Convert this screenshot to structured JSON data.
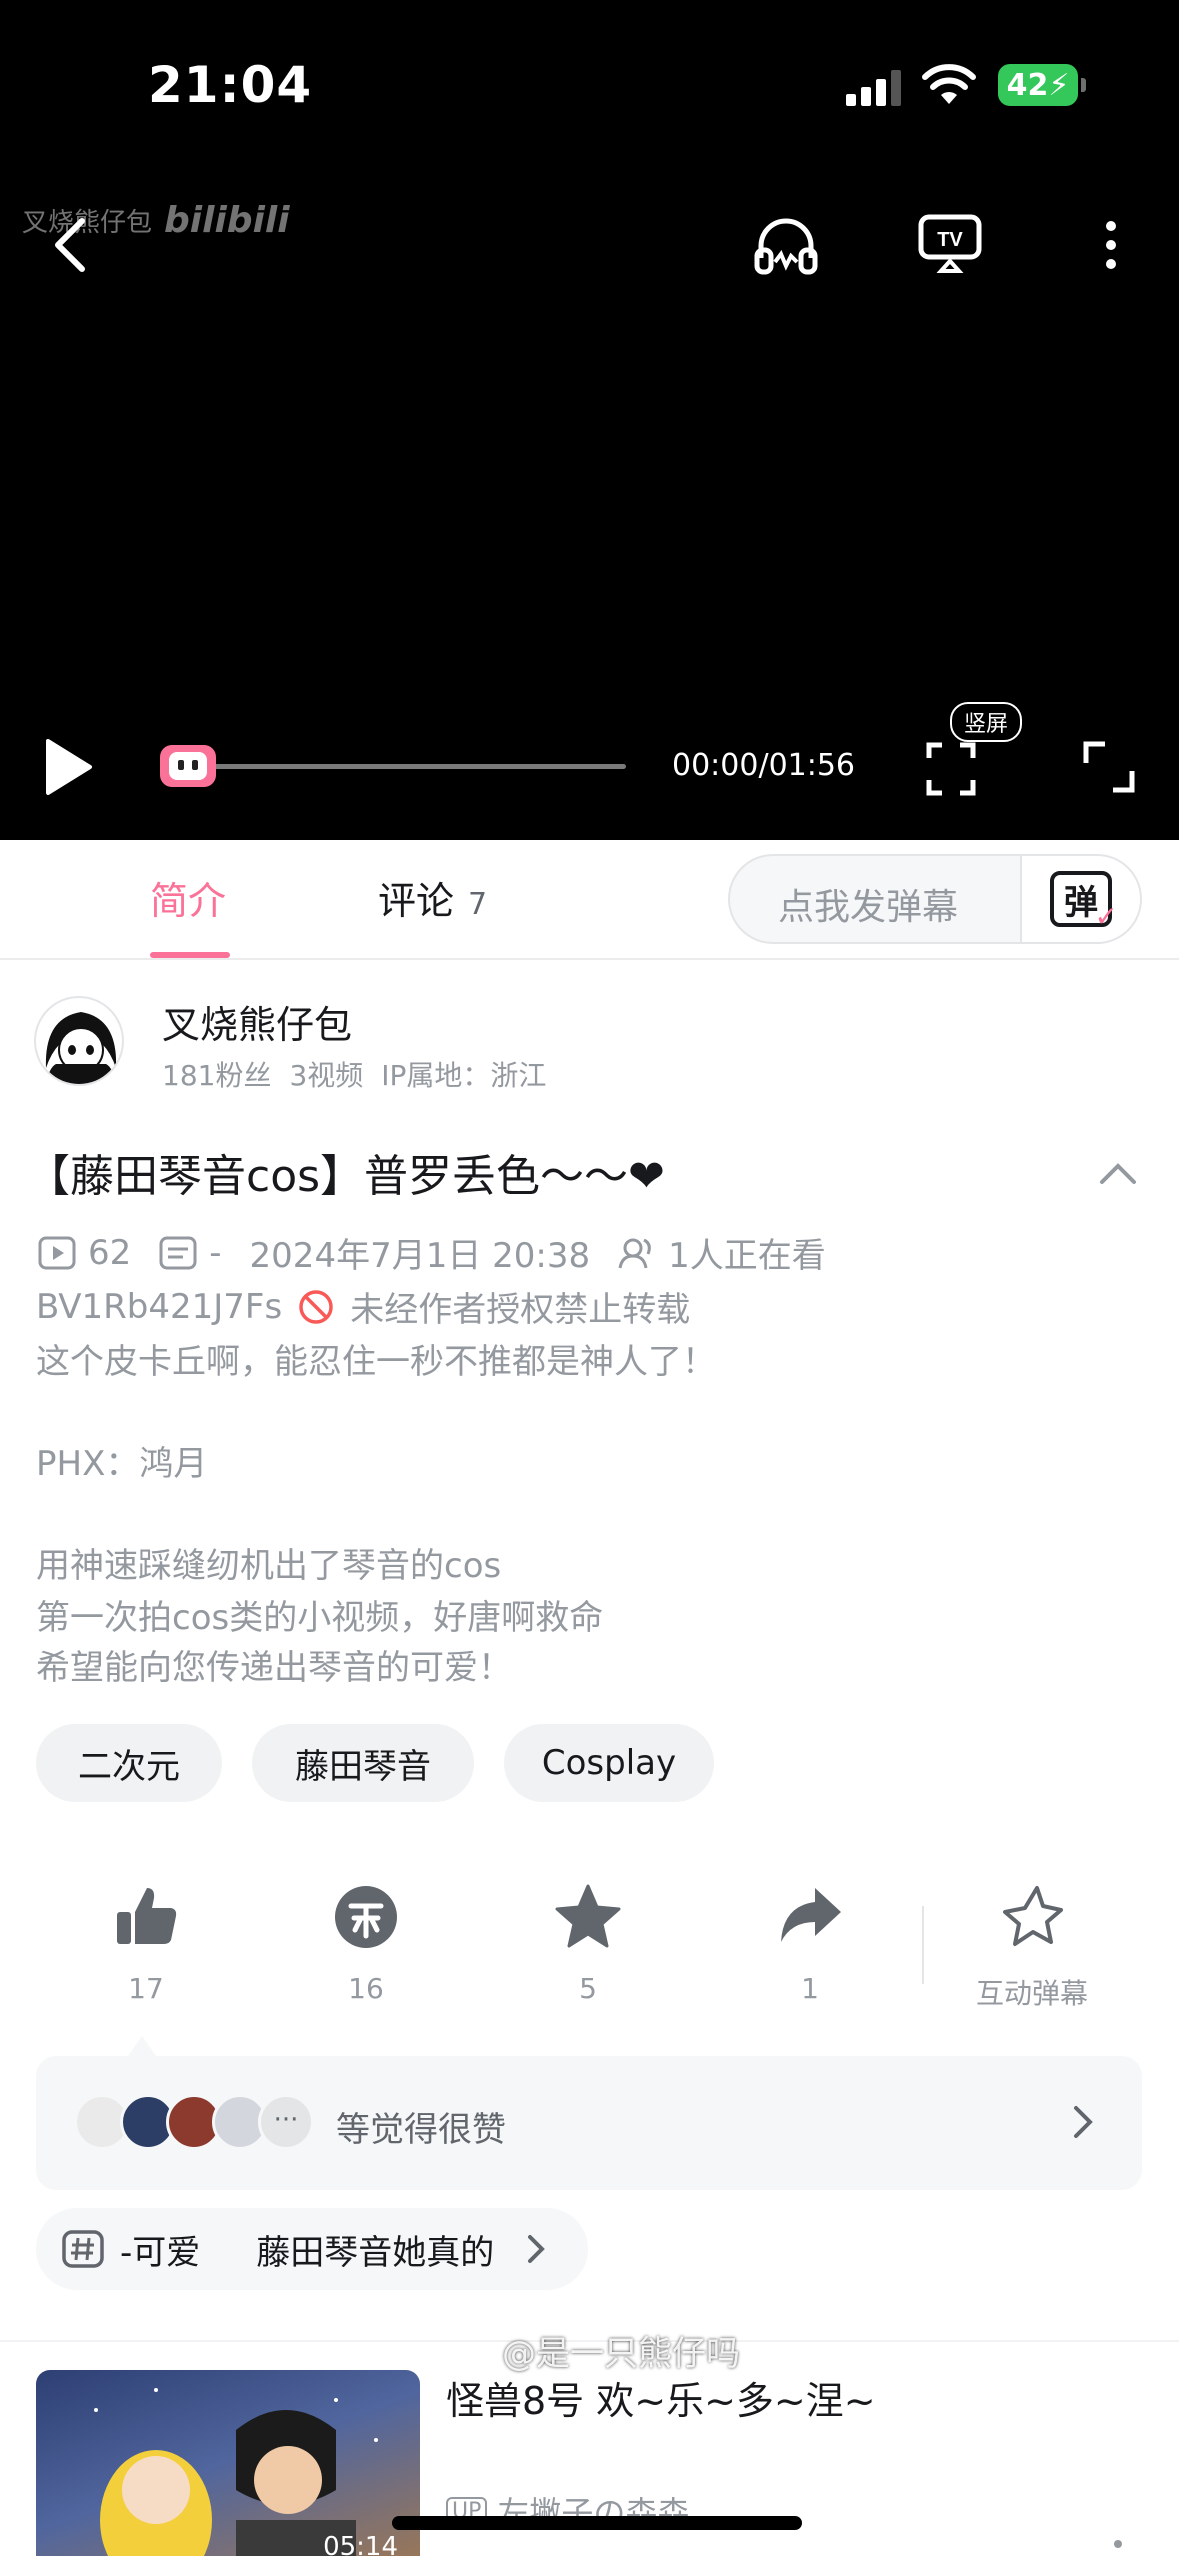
{
  "status_bar": {
    "time": "21:04",
    "battery": "42"
  },
  "player": {
    "watermark_name": "叉烧熊仔包",
    "watermark_logo": "bilibili",
    "time": "00:00/01:56",
    "portrait_label": "竖屏",
    "progress": 0
  },
  "tabs": {
    "intro": "简介",
    "comments": "评论",
    "comments_count": "7",
    "danmaku_placeholder": "点我发弹幕",
    "danmaku_switch_glyph": "弹"
  },
  "uploader": {
    "name": "叉烧熊仔包",
    "fans": "181粉丝",
    "videos": "3视频",
    "ip": "IP属地：浙江"
  },
  "video": {
    "title": "【藤田琴音cos】普罗丢色～～❤",
    "plays": "62",
    "danmaku": "-",
    "date": "2024年7月1日 20:38",
    "watching": "1人正在看",
    "bvid": "BV1Rb421J7Fs",
    "copyright": "未经作者授权禁止转载",
    "description": [
      "这个皮卡丘啊，能忍住一秒不推都是神人了！",
      "",
      "PHX：鸿月",
      "",
      "用神速踩缝纫机出了琴音的cos",
      "第一次拍cos类的小视频，好唐啊救命",
      "希望能向您传递出琴音的可爱！"
    ],
    "tags": [
      "二次元",
      "藤田琴音",
      "Cosplay"
    ]
  },
  "actions": {
    "like": "17",
    "coin": "16",
    "favorite": "5",
    "share": "1",
    "interactive": "互动弹幕"
  },
  "like_bar": {
    "text": "等觉得很赞"
  },
  "topics": [
    "-可爱",
    "藤田琴音她真的"
  ],
  "recommendation": {
    "title": "怪兽8号  欢~乐~多~涅~",
    "duration": "05:14",
    "uploader": "左撇子の森森",
    "up_badge": "UP"
  },
  "overlay": {
    "weibo_watermark": "@是一只熊仔吗"
  },
  "colors": {
    "accent": "#fb7299",
    "text": "#18191c",
    "muted": "#9499a0",
    "battery": "#34c759"
  }
}
